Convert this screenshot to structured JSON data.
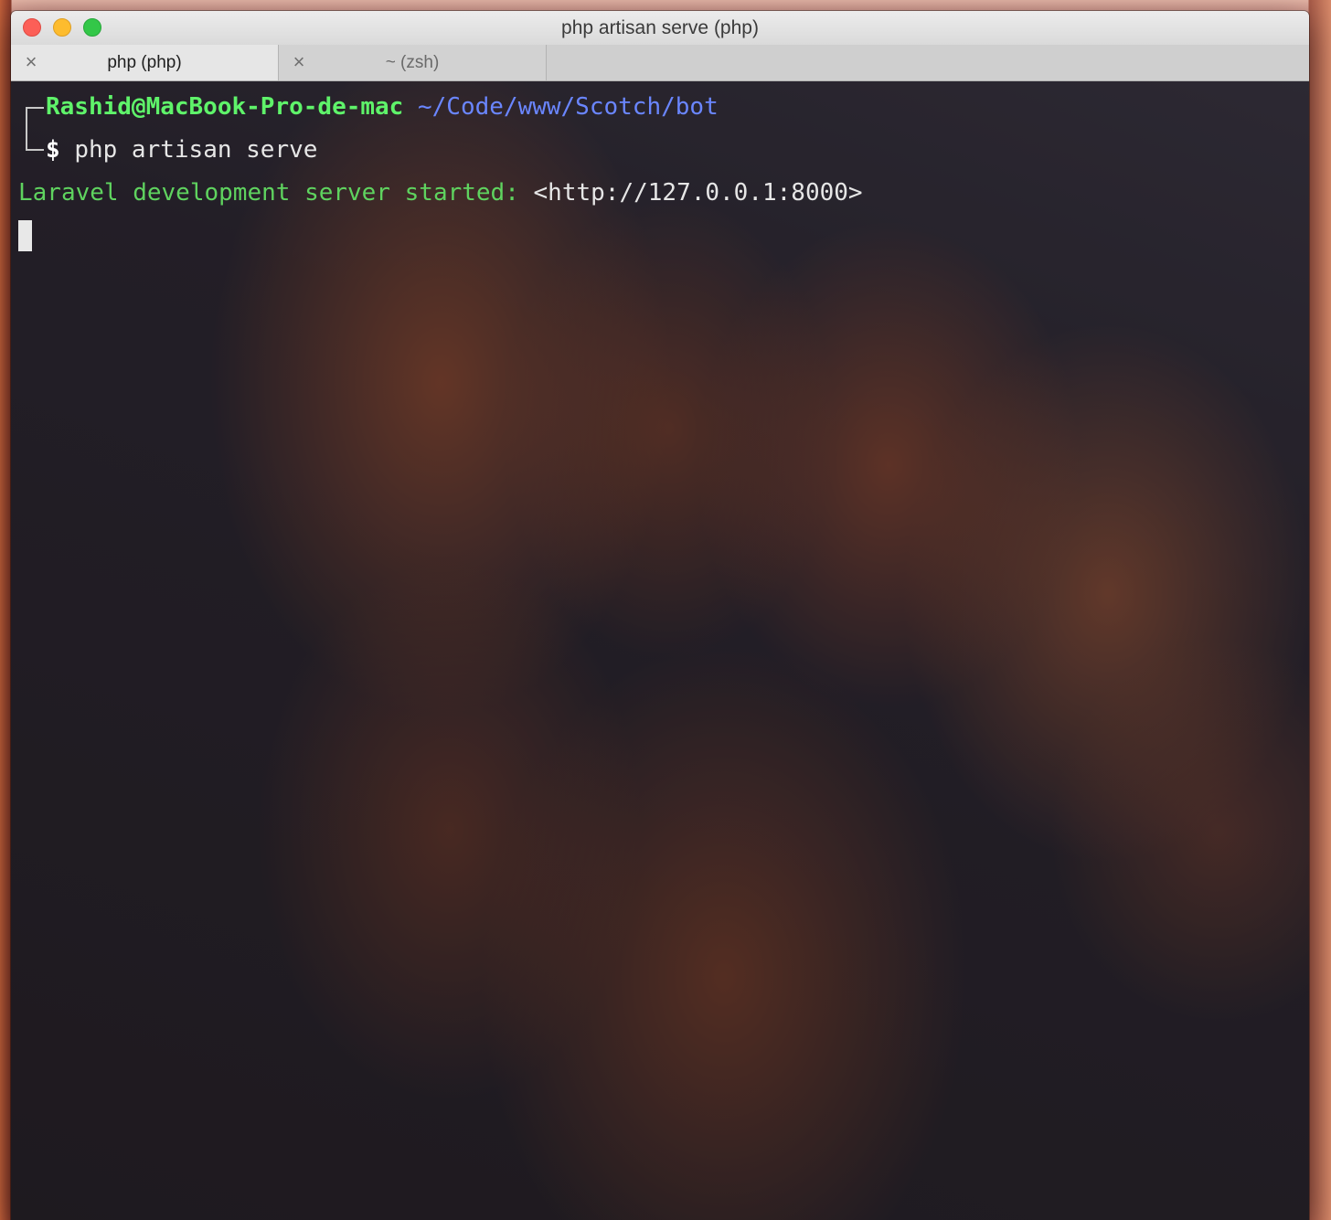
{
  "window": {
    "title": "php artisan serve (php)"
  },
  "tabs": [
    {
      "label": "php (php)",
      "active": true
    },
    {
      "label": "~ (zsh)",
      "active": false
    }
  ],
  "terminal": {
    "user_host": "Rashid@MacBook-Pro-de-mac",
    "cwd": "~/Code/www/Scotch/bot",
    "prompt_symbol": "$",
    "command": "php artisan serve",
    "output_label": "Laravel development server started:",
    "output_url": "<http://127.0.0.1:8000>"
  },
  "icons": {
    "close": "×"
  },
  "colors": {
    "user_host": "#5ff36a",
    "cwd": "#6a86ff",
    "server_msg": "#5fd35f",
    "close_button": "#fc5f57",
    "minimize_button": "#fdbc2e",
    "maximize_button": "#33c748"
  }
}
